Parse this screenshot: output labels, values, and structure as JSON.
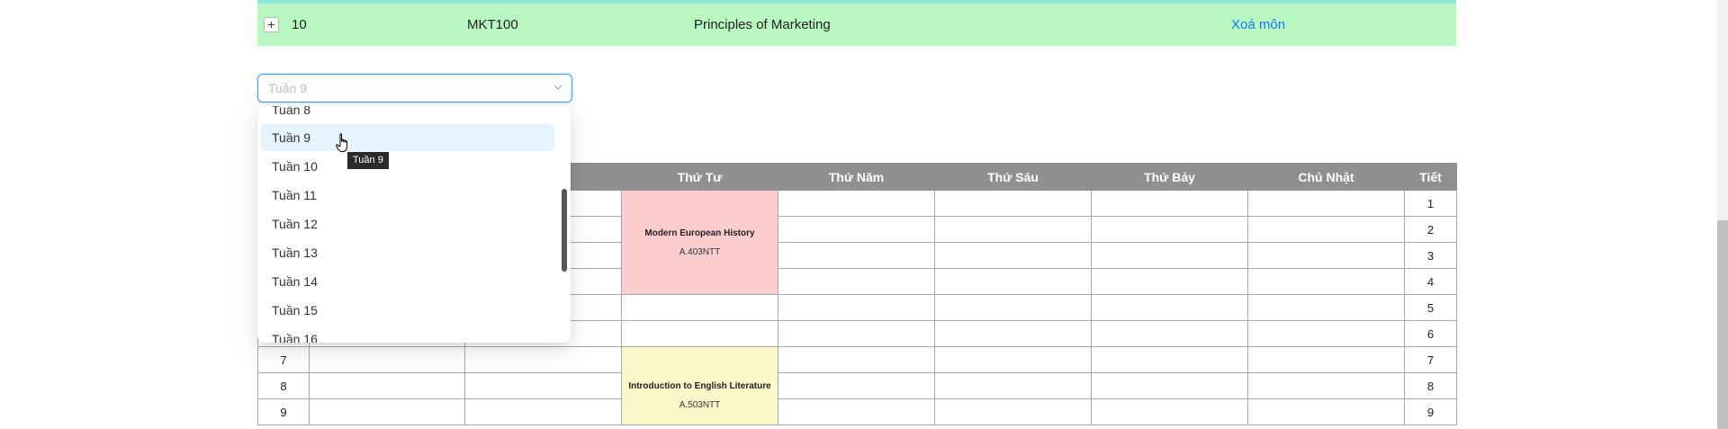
{
  "course_row": {
    "index": "10",
    "code": "MKT100",
    "name": "Principles of Marketing",
    "delete_label": "Xoá môn",
    "expand_icon": "+"
  },
  "week_select": {
    "value": "Tuần 9",
    "options": [
      "Tuần 8",
      "Tuần 9",
      "Tuần 10",
      "Tuần 11",
      "Tuần 12",
      "Tuần 13",
      "Tuần 14",
      "Tuần 15",
      "Tuần 16"
    ],
    "hovered": "Tuần 9",
    "tooltip": "Tuần 9"
  },
  "timetable": {
    "headers": [
      "",
      "",
      "",
      "Thứ Tư",
      "Thứ Năm",
      "Thứ Sáu",
      "Thứ Bảy",
      "Chủ Nhật",
      "Tiết"
    ],
    "periods": [
      "1",
      "2",
      "3",
      "4",
      "5",
      "6",
      "7",
      "8",
      "9"
    ],
    "lessons": [
      {
        "title": "Modern European History",
        "room": "A.403NTT",
        "color": "#fccdcf"
      },
      {
        "title": "Introduction to English Literature",
        "room": "A.503NTT",
        "color": "#fbf7c9"
      }
    ]
  },
  "colors": {
    "row_highlight": "#b8f7c1",
    "link": "#1677ff",
    "header_bg": "#909090"
  }
}
